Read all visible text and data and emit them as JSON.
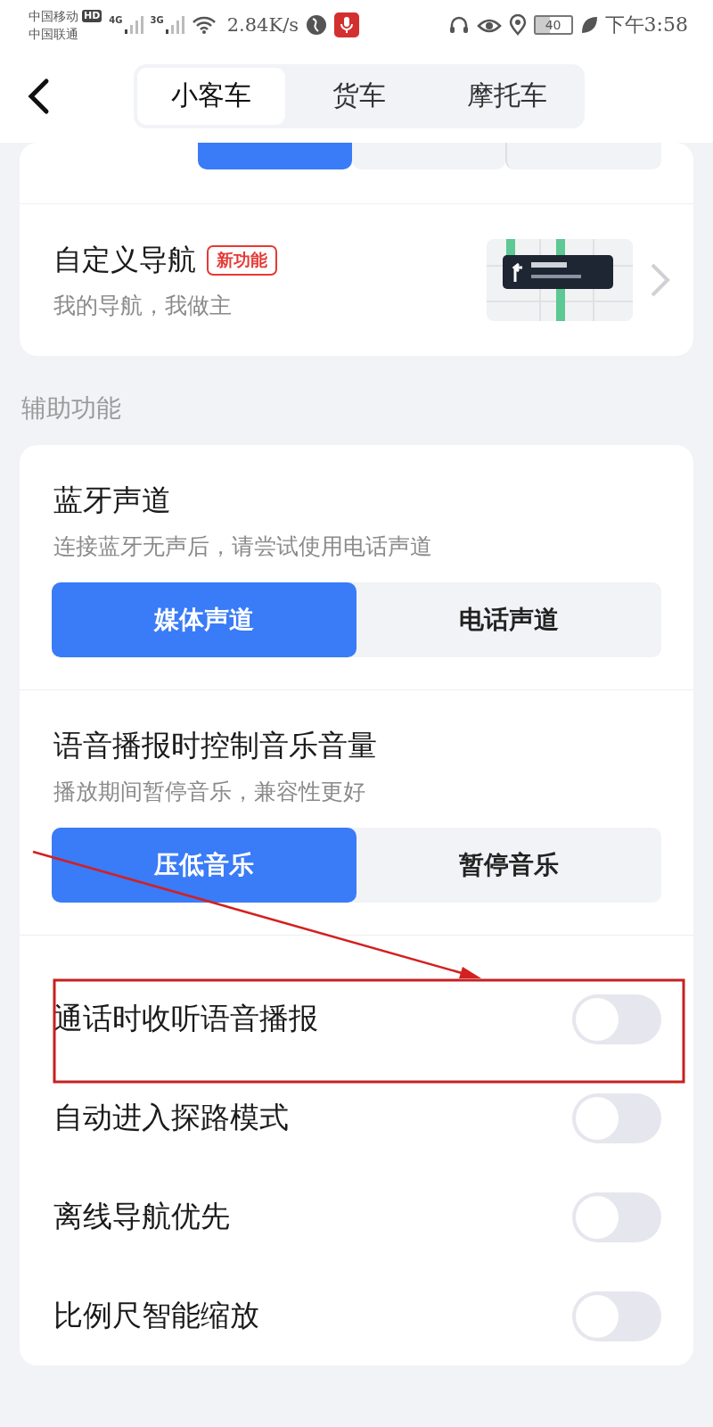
{
  "status_bar": {
    "carrier_1": "中国移动",
    "hd": "HD",
    "carrier_2": "中国联通",
    "net_1": "4G",
    "net_2": "3G",
    "speed": "2.84K/s",
    "battery": "40",
    "time": "下午3:58"
  },
  "tabs": [
    {
      "label": "小客车",
      "selected": true
    },
    {
      "label": "货车",
      "selected": false
    },
    {
      "label": "摩托车",
      "selected": false
    }
  ],
  "partial_row": {
    "segments": [
      {
        "selected": true
      },
      {
        "selected": false
      },
      {
        "selected": false
      }
    ]
  },
  "custom_nav": {
    "title": "自定义导航",
    "badge": "新功能",
    "subtitle": "我的导航，我做主"
  },
  "section_label": "辅助功能",
  "choice_settings": [
    {
      "title": "蓝牙声道",
      "subtitle": "连接蓝牙无声后，请尝试使用电话声道",
      "options": [
        {
          "label": "媒体声道",
          "selected": true
        },
        {
          "label": "电话声道",
          "selected": false
        }
      ]
    },
    {
      "title": "语音播报时控制音乐音量",
      "subtitle": "播放期间暂停音乐，兼容性更好",
      "options": [
        {
          "label": "压低音乐",
          "selected": true
        },
        {
          "label": "暂停音乐",
          "selected": false
        }
      ]
    }
  ],
  "toggles": [
    {
      "label": "通话时收听语音播报",
      "on": false
    },
    {
      "label": "自动进入探路模式",
      "on": false
    },
    {
      "label": "离线导航优先",
      "on": false
    },
    {
      "label": "比例尺智能缩放",
      "on": false
    }
  ],
  "annotations": {
    "arrow": true,
    "highlight_box": true
  }
}
